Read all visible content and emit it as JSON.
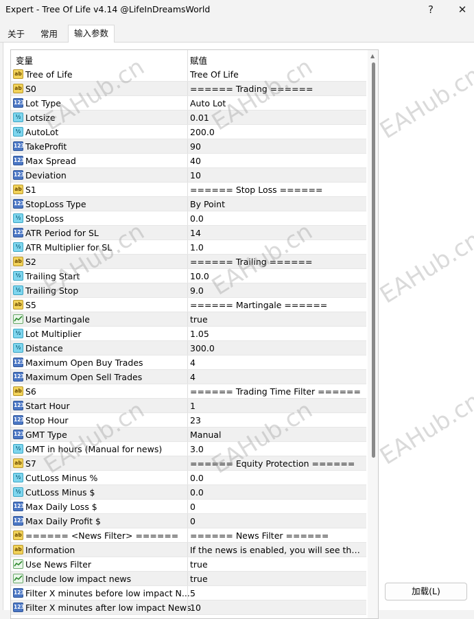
{
  "window": {
    "title": "Expert - Tree Of Life v4.14 @LifeInDreamsWorld",
    "help_label": "?",
    "close_label": "✕"
  },
  "tabs": [
    {
      "label": "关于"
    },
    {
      "label": "常用"
    },
    {
      "label": "输入参数"
    }
  ],
  "grid": {
    "col_variable": "变量",
    "col_value": "赋值",
    "rows": [
      {
        "type": "ab",
        "name": "Tree of Life",
        "value": "Tree Of Life"
      },
      {
        "type": "ab",
        "name": "S0",
        "value": "====== Trading ======"
      },
      {
        "type": "n123",
        "name": "Lot Type",
        "value": "Auto Lot"
      },
      {
        "type": "v2",
        "name": "Lotsize",
        "value": "0.01"
      },
      {
        "type": "v2",
        "name": "AutoLot",
        "value": "200.0"
      },
      {
        "type": "n123",
        "name": "TakeProfit",
        "value": "90"
      },
      {
        "type": "n123",
        "name": "Max Spread",
        "value": "40"
      },
      {
        "type": "n123",
        "name": "Deviation",
        "value": "10"
      },
      {
        "type": "ab",
        "name": "S1",
        "value": "====== Stop Loss ======"
      },
      {
        "type": "n123",
        "name": "StopLoss Type",
        "value": "By Point"
      },
      {
        "type": "v2",
        "name": "StopLoss",
        "value": "0.0"
      },
      {
        "type": "n123",
        "name": "ATR Period for SL",
        "value": "14"
      },
      {
        "type": "v2",
        "name": "ATR Multiplier for SL",
        "value": "1.0"
      },
      {
        "type": "ab",
        "name": "S2",
        "value": "====== Trailing ======"
      },
      {
        "type": "v2",
        "name": "Trailing Start",
        "value": "10.0"
      },
      {
        "type": "v2",
        "name": "Trailing Stop",
        "value": "9.0"
      },
      {
        "type": "ab",
        "name": "S5",
        "value": "====== Martingale ======"
      },
      {
        "type": "bool",
        "name": "Use Martingale",
        "value": "true"
      },
      {
        "type": "v2",
        "name": "Lot Multiplier",
        "value": "1.05"
      },
      {
        "type": "v2",
        "name": "Distance",
        "value": "300.0"
      },
      {
        "type": "n123",
        "name": "Maximum Open Buy Trades",
        "value": "4"
      },
      {
        "type": "n123",
        "name": "Maximum Open Sell Trades",
        "value": "4"
      },
      {
        "type": "ab",
        "name": "S6",
        "value": "====== Trading Time Filter ======"
      },
      {
        "type": "n123",
        "name": "Start Hour",
        "value": "1"
      },
      {
        "type": "n123",
        "name": "Stop Hour",
        "value": "23"
      },
      {
        "type": "n123",
        "name": "GMT Type",
        "value": "Manual"
      },
      {
        "type": "v2",
        "name": "GMT in hours (Manual for news)",
        "value": "3.0"
      },
      {
        "type": "ab",
        "name": "S7",
        "value": "====== Equity Protection ======"
      },
      {
        "type": "v2",
        "name": "CutLoss Minus %",
        "value": "0.0"
      },
      {
        "type": "v2",
        "name": "CutLoss Minus $",
        "value": "0.0"
      },
      {
        "type": "n123",
        "name": "Max Daily Loss $",
        "value": "0"
      },
      {
        "type": "n123",
        "name": "Max Daily Profit $",
        "value": "0"
      },
      {
        "type": "ab",
        "name": "====== <News Filter> ======",
        "value": "====== News Filter ======"
      },
      {
        "type": "ab",
        "name": "Information",
        "value": "If the news is enabled, you will see the lin..."
      },
      {
        "type": "bool",
        "name": "Use News Filter",
        "value": "true"
      },
      {
        "type": "bool",
        "name": "Include low impact news",
        "value": "true"
      },
      {
        "type": "n123",
        "name": "Filter X minutes before low impact N...",
        "value": "5"
      },
      {
        "type": "n123",
        "name": "Filter X minutes after low impact News",
        "value": "10"
      }
    ]
  },
  "icons": {
    "ab": "ab",
    "n123": "123",
    "v2": "½",
    "bool": "bool-icon"
  },
  "load_button": {
    "label": "加载(L)"
  },
  "watermark": {
    "text": "EAHub.cn"
  }
}
